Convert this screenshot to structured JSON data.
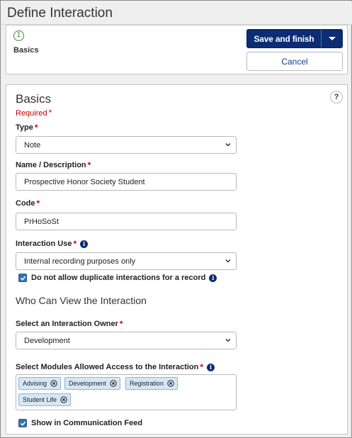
{
  "page": {
    "title": "Define Interaction"
  },
  "steps": [
    {
      "number": "1",
      "label": "Basics",
      "status_color": "#3a8a2e"
    }
  ],
  "actions": {
    "save_label": "Save and finish",
    "cancel_label": "Cancel",
    "primary_color": "#0c2c74"
  },
  "basics": {
    "title": "Basics",
    "help_label": "?",
    "required_label": "Required",
    "required_marker": "*",
    "type": {
      "label": "Type",
      "value": "Note"
    },
    "name": {
      "label": "Name / Description",
      "value": "Prospective Honor Society Student"
    },
    "code": {
      "label": "Code",
      "value": "PrHoSoSt"
    },
    "interaction_use": {
      "label": "Interaction Use",
      "value": "Internal recording purposes only"
    },
    "no_duplicates": {
      "label": "Do not allow duplicate interactions for a record",
      "checked": true
    }
  },
  "visibility": {
    "title": "Who Can View the Interaction",
    "owner": {
      "label": "Select an Interaction Owner",
      "value": "Development"
    },
    "modules": {
      "label": "Select Modules Allowed Access to the Interaction",
      "tags": [
        "Advising",
        "Development",
        "Registration",
        "Student Life"
      ]
    },
    "show_in_feed": {
      "label": "Show in Communication Feed",
      "checked": true
    }
  },
  "icons": {
    "info": "info-circle-icon",
    "remove": "close-circle-icon",
    "dropdown": "chevron-down-icon",
    "caret": "caret-down-icon",
    "check": "checkmark-icon",
    "help": "question-icon"
  },
  "colors": {
    "required": "#c00000",
    "tag_bg": "#d5e7f7",
    "checkbox": "#3572b0"
  }
}
